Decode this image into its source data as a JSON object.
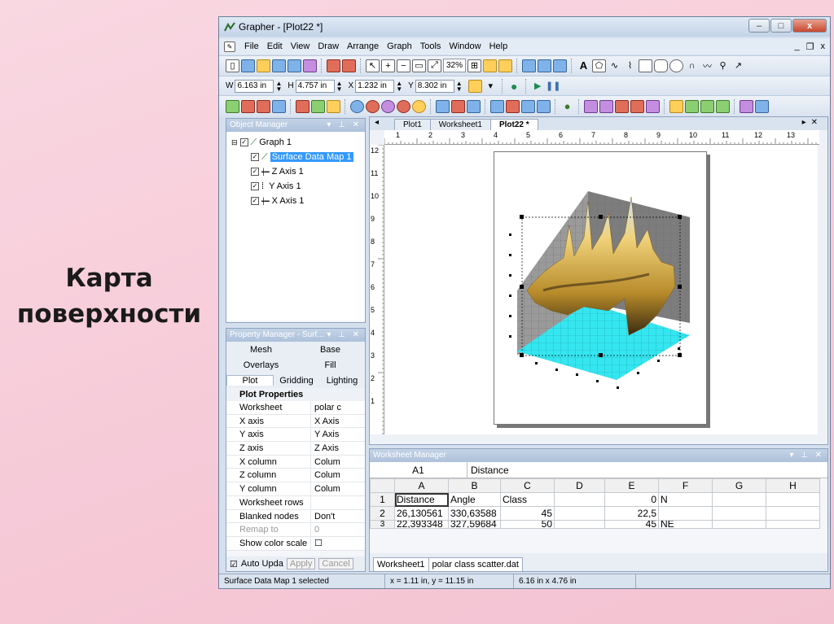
{
  "slide": {
    "title_line1": "Карта",
    "title_line2": "поверхности"
  },
  "window": {
    "title": "Grapher - [Plot22 *]",
    "buttons": {
      "minimize": "–",
      "maximize": "□",
      "close": "x"
    }
  },
  "menu": [
    "File",
    "Edit",
    "View",
    "Draw",
    "Arrange",
    "Graph",
    "Tools",
    "Window",
    "Help"
  ],
  "mdi_buttons": {
    "min": "_",
    "restore": "❐",
    "close": "x"
  },
  "toolbar": {
    "zoom": "32%"
  },
  "position": {
    "w_label": "W",
    "w_value": "6.163 in",
    "h_label": "H",
    "h_value": "4.757 in",
    "x_label": "X",
    "x_value": "1.232 in",
    "y_label": "Y",
    "y_value": "8.302 in"
  },
  "object_manager": {
    "title": "Object Manager",
    "items": [
      {
        "label": "Graph 1",
        "level": 0
      },
      {
        "label": "Surface Data Map 1",
        "level": 1,
        "selected": true
      },
      {
        "label": "Z Axis 1",
        "level": 1
      },
      {
        "label": "Y Axis 1",
        "level": 1
      },
      {
        "label": "X Axis 1",
        "level": 1
      }
    ]
  },
  "property_manager": {
    "title": "Property Manager - Surf...",
    "tabs_row1": [
      "Mesh",
      "Base"
    ],
    "tabs_row2": [
      "Overlays",
      "Fill"
    ],
    "tabs_row3": [
      "Plot",
      "Gridding",
      "Lighting"
    ],
    "section": "Plot Properties",
    "rows": [
      {
        "k": "Worksheet",
        "v": "polar c"
      },
      {
        "k": "X axis",
        "v": "X Axis"
      },
      {
        "k": "Y axis",
        "v": "Y Axis"
      },
      {
        "k": "Z axis",
        "v": "Z Axis"
      },
      {
        "k": "X column",
        "v": "Colum"
      },
      {
        "k": "Z column",
        "v": "Colum"
      },
      {
        "k": "Y column",
        "v": "Colum"
      },
      {
        "k": "Worksheet rows",
        "v": ""
      },
      {
        "k": "Blanked nodes",
        "v": "Don't"
      },
      {
        "k": "Remap to",
        "v": "0",
        "dim": true
      },
      {
        "k": "Show color scale",
        "v": "☐"
      }
    ],
    "auto_update": "Auto Upda",
    "apply": "Apply",
    "cancel": "Cancel"
  },
  "doc_tabs": [
    "Plot1",
    "Worksheet1",
    "Plot22 *"
  ],
  "ruler": {
    "top": [
      "1",
      "2",
      "3",
      "4",
      "5",
      "6",
      "7",
      "8",
      "9",
      "10",
      "11",
      "12",
      "13"
    ],
    "left": [
      "12",
      "11",
      "10",
      "9",
      "8",
      "7",
      "6",
      "5",
      "4",
      "3",
      "2",
      "1"
    ]
  },
  "worksheet_manager": {
    "title": "Worksheet Manager",
    "cell_ref": "A1",
    "cell_value": "Distance",
    "columns": [
      "A",
      "B",
      "C",
      "D",
      "E",
      "F",
      "G",
      "H"
    ],
    "rows": [
      {
        "n": "1",
        "cells": [
          "Distance",
          "Angle",
          "Class",
          "",
          "0",
          "N",
          "",
          ""
        ]
      },
      {
        "n": "2",
        "cells": [
          "26,130561",
          "330,63588",
          "45",
          "",
          "22,5",
          "",
          "",
          ""
        ]
      },
      {
        "n": "3",
        "cells": [
          "22,393348",
          "327,59684",
          "50",
          "",
          "45",
          "NE",
          "",
          ""
        ]
      }
    ],
    "sheet_tabs": [
      "Worksheet1",
      "polar class scatter.dat"
    ]
  },
  "status": {
    "selection": "Surface Data Map 1 selected",
    "coords": "x = 1.11 in, y = 11.15 in",
    "size": "6.16 in x 4.76 in"
  },
  "colors": {
    "surface": "#d9b24a",
    "base": "#35e6f0",
    "wall": "#8c8c8c",
    "selection": "#3399ff"
  }
}
